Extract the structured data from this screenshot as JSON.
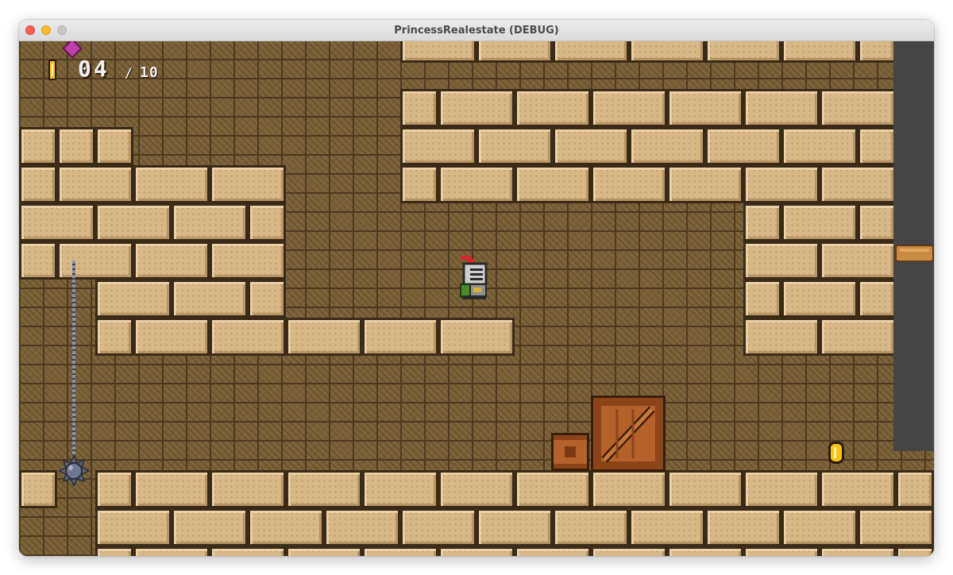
{
  "window": {
    "title": "PrincessRealestate (DEBUG)",
    "traffic_lights": {
      "close": "close-button",
      "minimize": "minimize-button",
      "zoom": "zoom-button"
    }
  },
  "hud": {
    "gem_icon": "gem-icon",
    "coin_icon": "coin-icon",
    "coins_collected": "04",
    "separator": "/",
    "coins_total": "10"
  },
  "scene": {
    "player": "knight-icon",
    "hazard": "spiked-ball-icon",
    "pickup": "coin-icon",
    "objects": [
      "wooden-crate",
      "wooden-crate-small",
      "wooden-ledge"
    ]
  },
  "colors": {
    "brick_face": "#d9b887",
    "brick_mortar": "#3a2a18",
    "back_wall": "#7a6138",
    "dark_wall": "#454545",
    "coin_gold": "#f7c31a",
    "gem_magenta": "#c23ea8",
    "crate_wood": "#b5622a"
  }
}
